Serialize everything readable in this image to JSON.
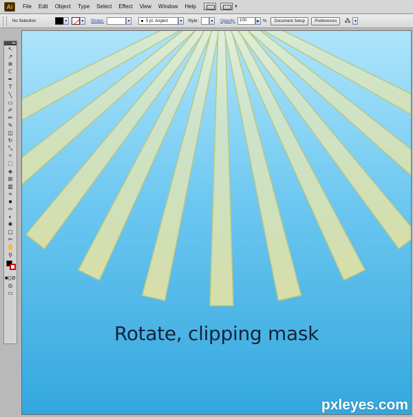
{
  "app": {
    "logo_text": "Ai"
  },
  "menu": {
    "items": [
      "File",
      "Edit",
      "Object",
      "Type",
      "Select",
      "Effect",
      "View",
      "Window",
      "Help"
    ]
  },
  "control_bar": {
    "selection_label": "No Selection",
    "stroke_label": "Stroke:",
    "brush_label": "5 pt. Angled",
    "style_label": "Style:",
    "opacity_label": "Opacity:",
    "opacity_value": "100",
    "percent": "%",
    "document_setup_label": "Document Setup",
    "preferences_label": "Preferences"
  },
  "toolbox": {
    "tools": [
      "selection-tool",
      "direct-selection-tool",
      "magic-wand-tool",
      "lasso-tool",
      "pen-tool",
      "type-tool",
      "line-segment-tool",
      "rectangle-tool",
      "paintbrush-tool",
      "pencil-tool",
      "blob-brush-tool",
      "eraser-tool",
      "rotate-tool",
      "scale-tool",
      "warp-tool",
      "free-transform-tool",
      "shape-builder-tool",
      "perspective-grid-tool",
      "column-graph-tool",
      "mesh-tool",
      "gradient-tool",
      "eyedropper-tool",
      "blend-tool",
      "symbol-sprayer-tool",
      "artboard-tool",
      "slice-tool",
      "hand-tool",
      "zoom-tool"
    ],
    "tool_glyphs": [
      "↖",
      "↗",
      "✲",
      "ᑕ",
      "✒",
      "T",
      "╲",
      "▭",
      "✐",
      "✏",
      "✎",
      "◫",
      "↻",
      "⤡",
      "≈",
      "⬚",
      "◈",
      "⊞",
      "▥",
      "⌗",
      "■",
      "✑",
      "◐",
      "✺",
      "▢",
      "✂",
      "✋",
      "⚲"
    ]
  },
  "canvas": {
    "caption": "Rotate, clipping mask",
    "watermark": "pxleyes.com",
    "colors": {
      "sky_top": "#aee4fb",
      "sky_bottom": "#33a7de",
      "ray_fill": "#d7dea8",
      "ray_edge": "#b9c684"
    }
  }
}
